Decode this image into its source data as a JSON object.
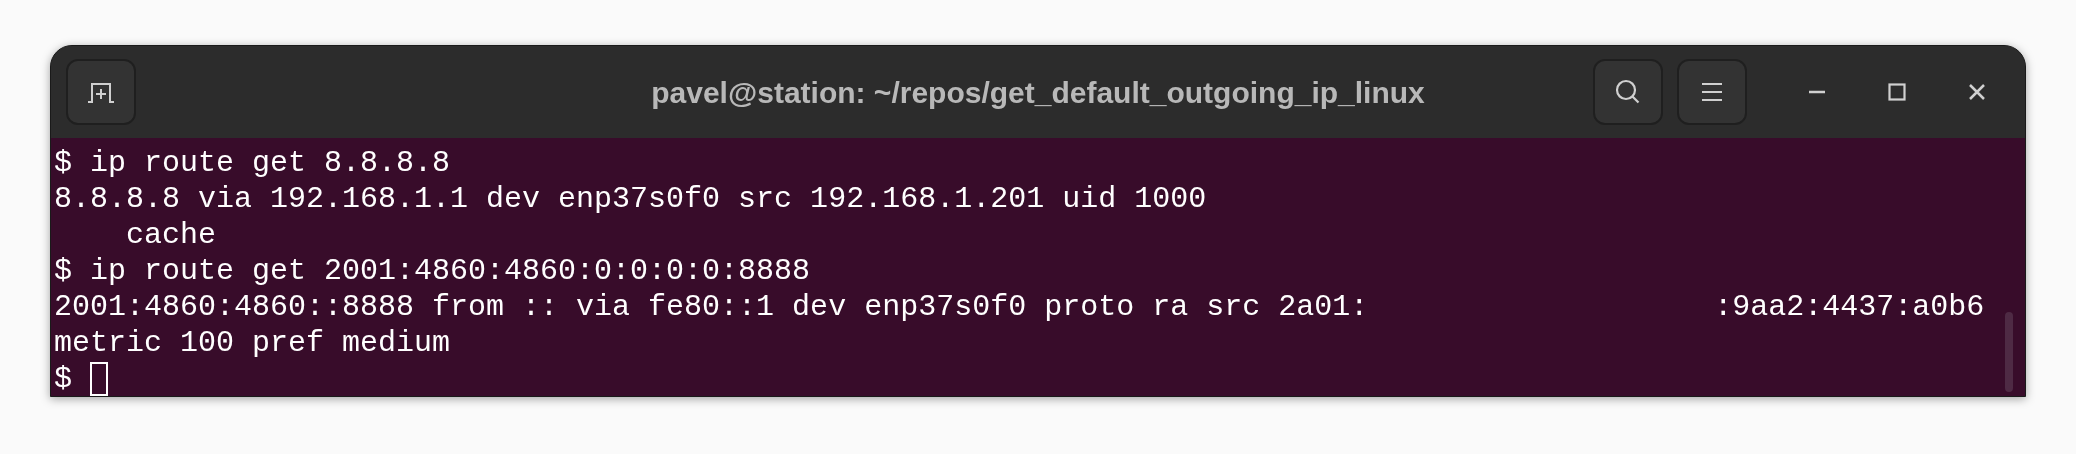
{
  "window": {
    "title": "pavel@station: ~/repos/get_default_outgoing_ip_linux"
  },
  "terminal": {
    "lines": [
      {
        "parts": [
          "$ ip route get 8.8.8.8"
        ]
      },
      {
        "parts": [
          "8.8.8.8 via 192.168.1.1 dev enp37s0f0 src 192.168.1.201 uid 1000"
        ]
      },
      {
        "parts": [
          "    cache"
        ]
      },
      {
        "parts": [
          "$ ip route get 2001:4860:4860:0:0:0:0:8888"
        ]
      },
      {
        "parts": [
          "2001:4860:4860::8888 from :: via fe80::1 dev enp37s0f0 proto ra src 2a01:",
          ":9aa2:4437:a0b6"
        ]
      },
      {
        "parts": [
          "metric 100 pref medium"
        ]
      }
    ],
    "prompt": "$"
  }
}
